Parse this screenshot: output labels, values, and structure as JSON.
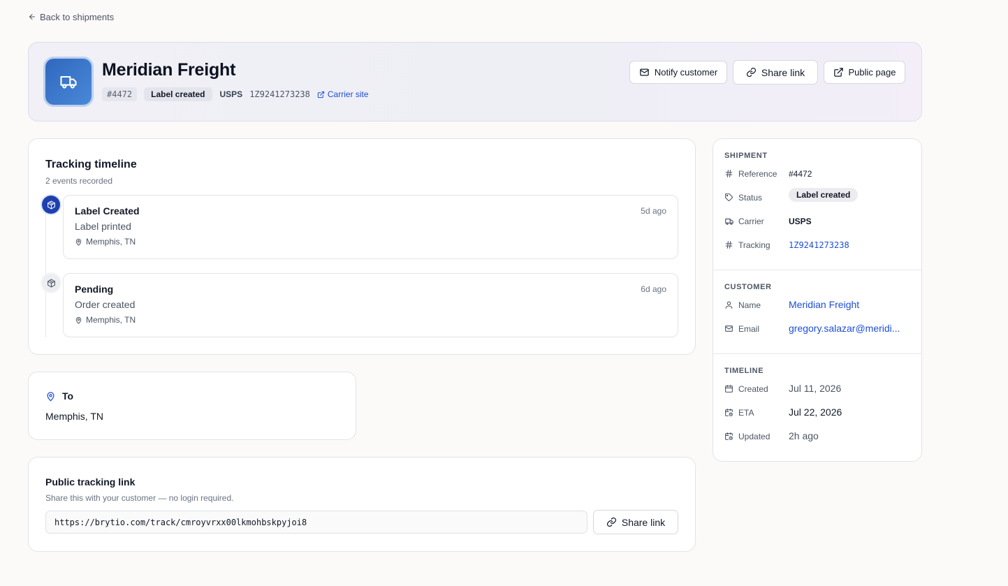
{
  "nav": {
    "back_label": "Back to shipments"
  },
  "header": {
    "title": "Meridian Freight",
    "reference": "#4472",
    "status": "Label created",
    "carrier": "USPS",
    "tracking_number": "1Z9241273238",
    "carrier_site_label": "Carrier site",
    "buttons": {
      "notify": "Notify customer",
      "share": "Share link",
      "public_page": "Public page"
    }
  },
  "timeline": {
    "title": "Tracking timeline",
    "subtitle": "2 events recorded",
    "events": [
      {
        "title": "Label Created",
        "time": "5d ago",
        "description": "Label printed",
        "location": "Memphis, TN",
        "active": true
      },
      {
        "title": "Pending",
        "time": "6d ago",
        "description": "Order created",
        "location": "Memphis, TN",
        "active": false
      }
    ]
  },
  "destination": {
    "label": "To",
    "value": "Memphis, TN"
  },
  "public_link": {
    "title": "Public tracking link",
    "subtitle": "Share this with your customer — no login required.",
    "url": "https://brytio.com/track/cmroyvrxx00lkmohbskpyjoi8",
    "button": "Share link"
  },
  "sidebar": {
    "shipment": {
      "heading": "SHIPMENT",
      "reference_label": "Reference",
      "reference_value": "#4472",
      "status_label": "Status",
      "status_value": "Label created",
      "carrier_label": "Carrier",
      "carrier_value": "USPS",
      "tracking_label": "Tracking",
      "tracking_value": "1Z9241273238"
    },
    "customer": {
      "heading": "CUSTOMER",
      "name_label": "Name",
      "name_value": "Meridian Freight",
      "email_label": "Email",
      "email_value": "gregory.salazar@meridi..."
    },
    "timeline": {
      "heading": "TIMELINE",
      "created_label": "Created",
      "created_value": "Jul 11, 2026",
      "eta_label": "ETA",
      "eta_value": "Jul 22, 2026",
      "updated_label": "Updated",
      "updated_value": "2h ago"
    }
  },
  "colors": {
    "accent": "#1e40af",
    "link": "#1d4ed8",
    "avatar": "#3a78cc"
  },
  "icons": [
    "arrow-left-icon",
    "truck-icon",
    "external-link-icon",
    "mail-icon",
    "link-icon",
    "package-icon",
    "map-pin-icon",
    "hash-icon",
    "tag-icon",
    "user-icon",
    "calendar-icon",
    "calendar-clock-icon"
  ]
}
